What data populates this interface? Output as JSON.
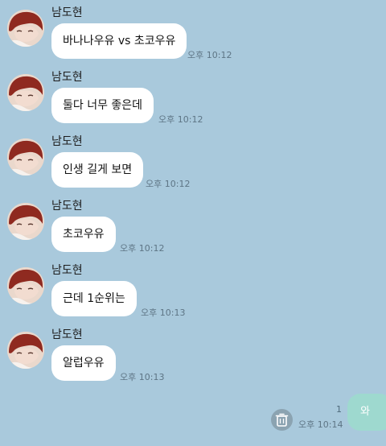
{
  "colors": {
    "background": "#a9c9dc",
    "incoming_bubble": "#ffffff",
    "outgoing_bubble": "#9ed9cf",
    "timestamp": "#5e7585"
  },
  "messages": [
    {
      "sender": "남도현",
      "text": "바나나우유 vs 초코우유",
      "time": "오후 10:12"
    },
    {
      "sender": "남도현",
      "text": "둘다 너무 좋은데",
      "time": "오후 10:12"
    },
    {
      "sender": "남도현",
      "text": "인생 길게 보면",
      "time": "오후 10:12"
    },
    {
      "sender": "남도현",
      "text": "초코우유",
      "time": "오후 10:12"
    },
    {
      "sender": "남도현",
      "text": "근데 1순위는",
      "time": "오후 10:13"
    },
    {
      "sender": "남도현",
      "text": "알럽우유",
      "time": "오후 10:13"
    }
  ],
  "my_message": {
    "text": "와",
    "time": "오후 10:14",
    "unread_count": "1"
  },
  "icons": {
    "trash": "trash-icon",
    "avatar": "profile-avatar"
  }
}
